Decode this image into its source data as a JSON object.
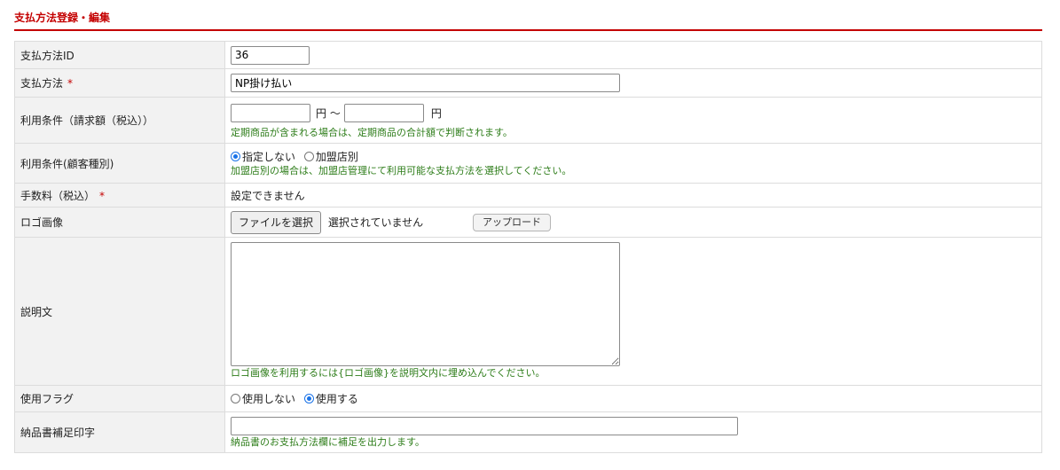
{
  "page": {
    "title": "支払方法登録・編集",
    "accent_color": "#c40000",
    "note_color": "#2e7d1a"
  },
  "rows": {
    "id": {
      "label": "支払方法ID",
      "value": "36"
    },
    "name": {
      "label": "支払方法",
      "required_mark": "*",
      "value": "NP掛け払い"
    },
    "amount_range": {
      "label": "利用条件（請求額（税込））",
      "min_value": "",
      "max_value": "",
      "unit_1": "円 〜",
      "unit_2": "円",
      "note": "定期商品が含まれる場合は、定期商品の合計額で判断されます。"
    },
    "customer_type": {
      "label": "利用条件(顧客種別)",
      "options": [
        {
          "label": "指定しない",
          "checked": true
        },
        {
          "label": "加盟店別",
          "checked": false
        }
      ],
      "note": "加盟店別の場合は、加盟店管理にて利用可能な支払方法を選択してください。"
    },
    "fee": {
      "label": "手数料（税込）",
      "required_mark": "*",
      "value": "設定できません"
    },
    "logo": {
      "label": "ロゴ画像",
      "file_button": "ファイルを選択",
      "file_status": "選択されていません",
      "upload_button": "アップロード"
    },
    "description": {
      "label": "説明文",
      "value": "",
      "note": "ロゴ画像を利用するには{ロゴ画像}を説明文内に埋め込んでください。"
    },
    "use_flag": {
      "label": "使用フラグ",
      "options": [
        {
          "label": "使用しない",
          "checked": false
        },
        {
          "label": "使用する",
          "checked": true
        }
      ]
    },
    "invoice_note": {
      "label": "納品書補足印字",
      "value": "",
      "note": "納品書のお支払方法欄に補足を出力します。"
    }
  }
}
